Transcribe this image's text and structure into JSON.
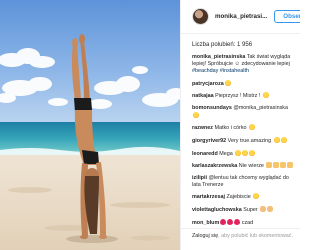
{
  "post": {
    "username": "monika_pietrasinska",
    "username_display": "monika_pietrasi...",
    "follow_label": "Obserwuj",
    "likes_label": "Liczba polubień: 1 956"
  },
  "comments": [
    {
      "author": "monika_pietrasinska",
      "text": "Tak świat wygląda lepiej! Spróbujcie ☺ zdecydowanie lepiej",
      "hashtags": "#beachday #instahealth"
    },
    {
      "author": "patrycjaroza",
      "text": "",
      "emoji": [
        "face"
      ]
    },
    {
      "author": "natkajaa",
      "text": "Pieprzysz ! Mistrz !",
      "emoji": [
        "face"
      ]
    },
    {
      "author": "bomonsundays",
      "text": "@monika_pietrasinska",
      "emoji": [
        "face"
      ]
    },
    {
      "author": "razwnez",
      "text": "Matko i córko",
      "emoji": [
        "face"
      ]
    },
    {
      "author": "giorgyriver92",
      "text": "Very true.amazing",
      "emoji": [
        "face",
        "face"
      ]
    },
    {
      "author": "leonaredd",
      "text": "Mega",
      "emoji": [
        "face",
        "face",
        "face"
      ]
    },
    {
      "author": "karlaszakrzewska",
      "text": "Nie wierze",
      "emoji": [
        "clap",
        "clap",
        "clap",
        "clap"
      ]
    },
    {
      "author": "izilipii",
      "text": "@lentuu tak chcemy wyglądać do lata Trenerze",
      "emoji": []
    },
    {
      "author": "martakrzesaj",
      "text": "Zajebiscie",
      "emoji": [
        "face"
      ]
    },
    {
      "author": "violettagluchowska",
      "text": "Super",
      "emoji": [
        "muscle",
        "muscle"
      ]
    },
    {
      "author": "mon_blum",
      "text": "",
      "emoji": [
        "heart-red",
        "heart-red",
        "heart-red"
      ],
      "suffix": "czad"
    }
  ],
  "footer": {
    "login_link": "Zaloguj się",
    "text": ", aby polubić lub skomentować."
  }
}
